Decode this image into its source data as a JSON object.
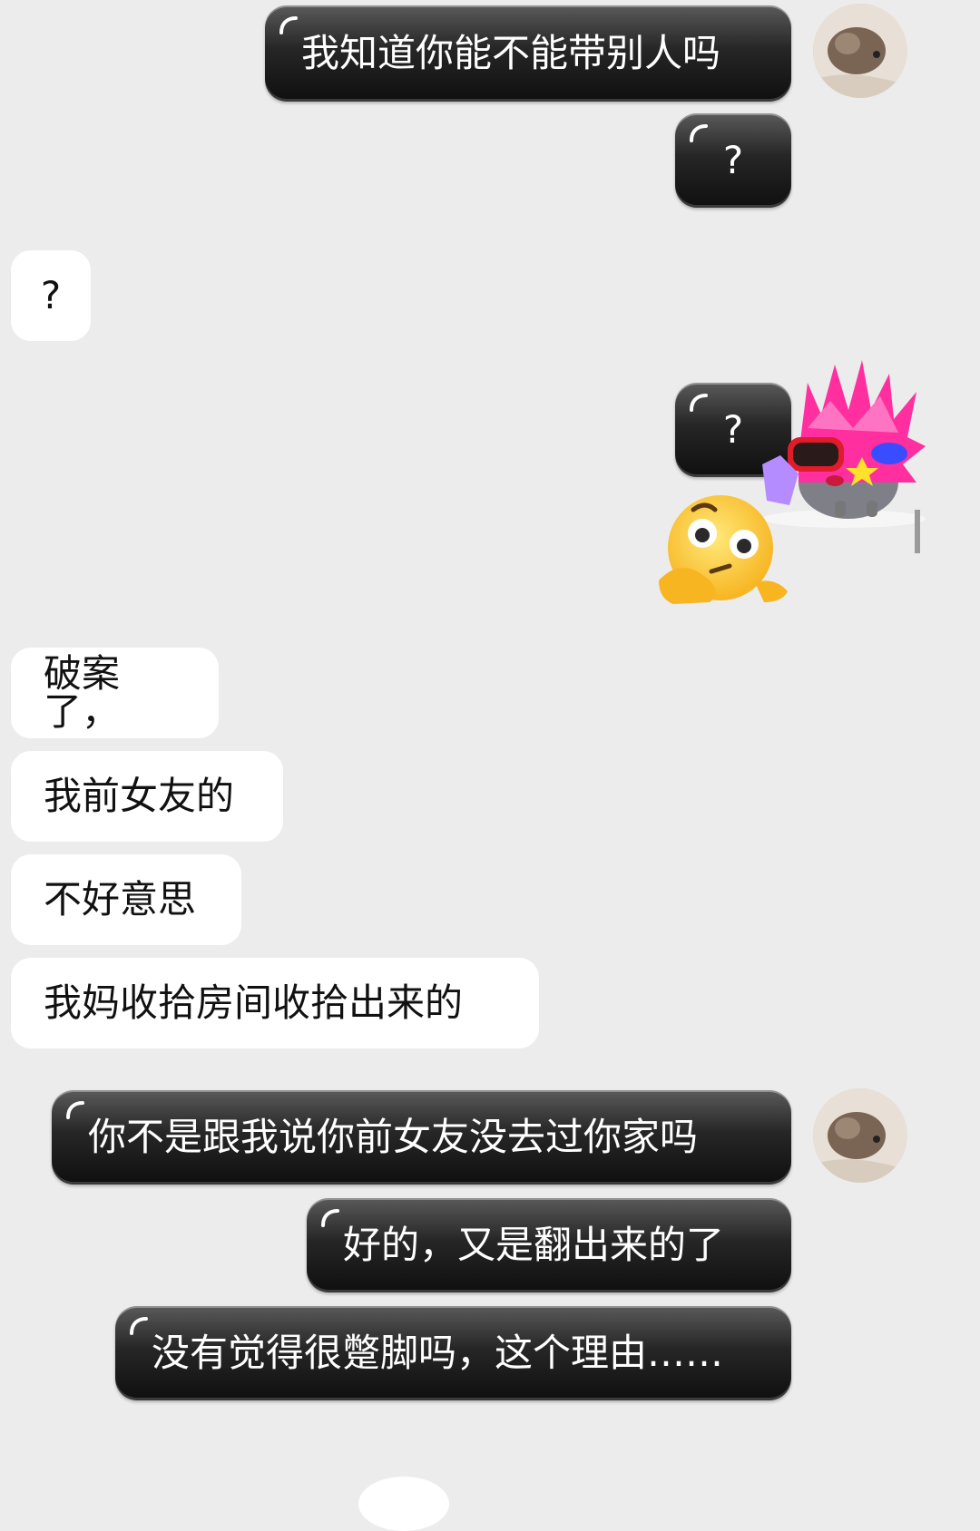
{
  "messages": [
    {
      "id": "m1",
      "side": "out",
      "text": "我知道你能不能带别人吗"
    },
    {
      "id": "m2",
      "side": "out",
      "text": "?"
    },
    {
      "id": "m3",
      "side": "in",
      "text": "?"
    },
    {
      "id": "m4",
      "side": "out",
      "text": "?"
    },
    {
      "id": "m5",
      "side": "in",
      "text": "破案了，"
    },
    {
      "id": "m6",
      "side": "in",
      "text": "我前女友的"
    },
    {
      "id": "m7",
      "side": "in",
      "text": "不好意思"
    },
    {
      "id": "m8",
      "side": "in",
      "text": "我妈收拾房间收拾出来的"
    },
    {
      "id": "m9",
      "side": "out",
      "text": "你不是跟我说你前女友没去过你家吗"
    },
    {
      "id": "m10",
      "side": "out",
      "text": "好的，又是翻出来的了"
    },
    {
      "id": "m11",
      "side": "out",
      "text": "没有觉得很蹩脚吗，这个理由……"
    }
  ],
  "stickers": [
    {
      "name": "pink-hedgehog-sticker",
      "icon": "pink-spiky-hedgehog-with-sunglasses"
    },
    {
      "name": "thinking-face-sticker",
      "icon": "thinking-face-emoji"
    }
  ],
  "colors": {
    "background": "#ececec",
    "incoming": "#ffffff",
    "outgoing": "#1a1a1a"
  }
}
